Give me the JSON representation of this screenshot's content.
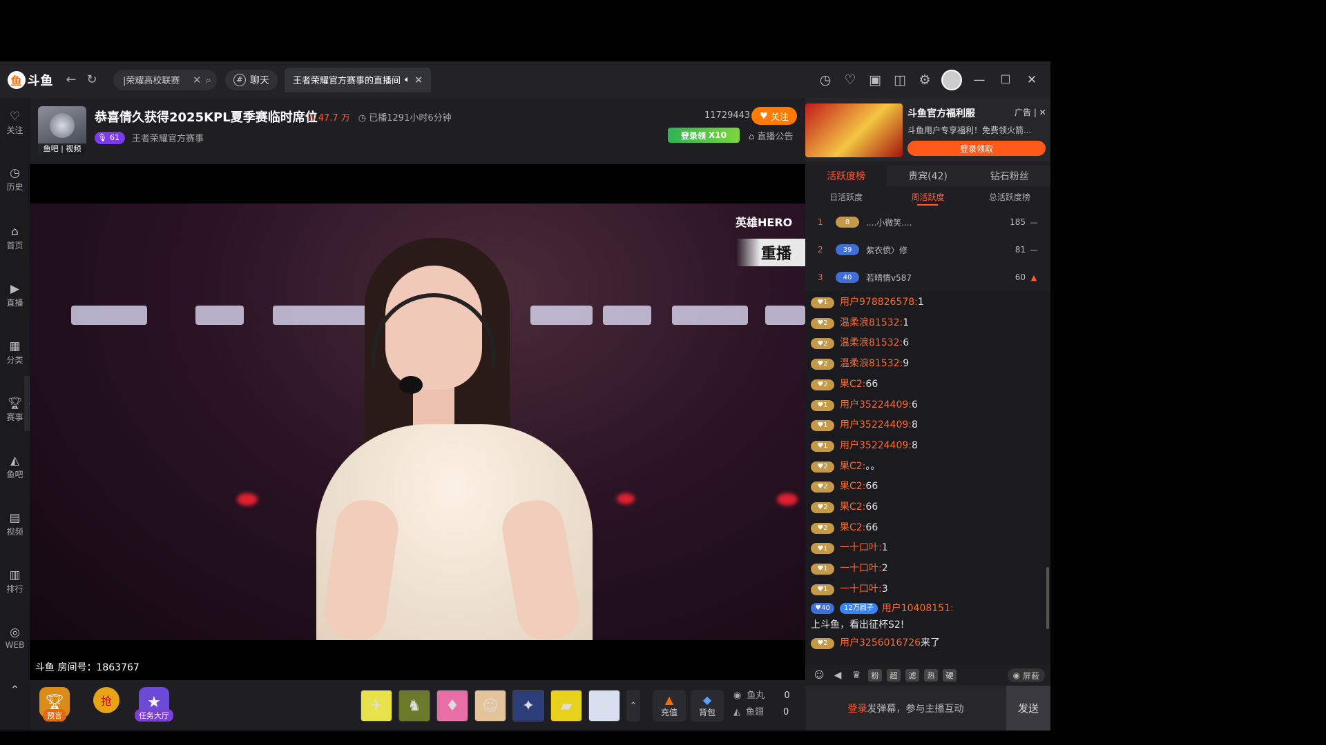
{
  "titlebar": {
    "logo_text": "斗鱼",
    "search_tab_text": "|荣耀高校联赛",
    "chat_tab_label": "聊天",
    "active_tab_label": "王者荣耀官方赛事的直播间"
  },
  "rail": {
    "items": [
      {
        "label": "关注",
        "icon": "heart-icon"
      },
      {
        "label": "历史",
        "icon": "clock-icon"
      },
      {
        "label": "首页",
        "icon": "home-icon"
      },
      {
        "label": "直播",
        "icon": "live-icon"
      },
      {
        "label": "分类",
        "icon": "grid-icon"
      },
      {
        "label": "赛事",
        "icon": "trophy-icon"
      },
      {
        "label": "鱼吧",
        "icon": "fish-bar-icon"
      },
      {
        "label": "视频",
        "icon": "video-icon"
      },
      {
        "label": "排行",
        "icon": "rank-icon"
      },
      {
        "label": "WEB",
        "icon": "web-icon"
      }
    ]
  },
  "room": {
    "title": "恭喜倩久获得2025KPL夏季赛临时席位",
    "heat": "47.7 万",
    "duration": "已播1291小时6分钟",
    "level": "61",
    "anchor_name": "王者荣耀官方赛事",
    "avatar_tag": "鱼吧 | 视频",
    "room_number_count": "11729443",
    "follow_label": "关注",
    "login_promo": "登录领",
    "login_promo_mult": "X10",
    "notice_label": "直播公告"
  },
  "video": {
    "hero_logo": "英雄HERO",
    "replay_label": "重播",
    "room_watermark": "斗鱼 房间号：1863767"
  },
  "bottom": {
    "predict_label": "预言",
    "grab_label": "抢",
    "task_label": "任务大厅",
    "recharge_label": "充值",
    "backpack_label": "背包",
    "fishball_label": "鱼丸",
    "fishball_value": "0",
    "fishwing_label": "鱼翅",
    "fishwing_value": "0"
  },
  "ad": {
    "title": "斗鱼官方福利服",
    "tag": "广告 |",
    "desc": "斗鱼用户专享福利！免费领火箭...",
    "button": "登录领取"
  },
  "rank": {
    "tabs": [
      "活跃度榜",
      "贵宾(42)",
      "钻石粉丝"
    ],
    "sub_tabs": [
      "日活跃度",
      "周活跃度",
      "总活跃度榜"
    ],
    "rows": [
      {
        "pos": "1",
        "level": "8",
        "name": "....小微笑....",
        "score": "185",
        "trend": "—"
      },
      {
        "pos": "2",
        "level": "39",
        "name": "紫衣偾〉修",
        "score": "81",
        "trend": "—"
      },
      {
        "pos": "3",
        "level": "40",
        "name": "若晴情v587",
        "score": "60",
        "trend": "▲"
      }
    ]
  },
  "chat": {
    "messages": [
      {
        "lv": "1",
        "user": "用户978826578:",
        "text": "1"
      },
      {
        "lv": "2",
        "user": "温柔浪81532:",
        "text": "1"
      },
      {
        "lv": "2",
        "user": "温柔浪81532:",
        "text": "6"
      },
      {
        "lv": "2",
        "user": "温柔浪81532:",
        "text": "9"
      },
      {
        "lv": "2",
        "user": "果C2:",
        "text": "66"
      },
      {
        "lv": "1",
        "user": "用户35224409:",
        "text": "6"
      },
      {
        "lv": "1",
        "user": "用户35224409:",
        "text": "8"
      },
      {
        "lv": "1",
        "user": "用户35224409:",
        "text": "8"
      },
      {
        "lv": "2",
        "user": "果C2:",
        "text": "。。"
      },
      {
        "lv": "2",
        "user": "果C2:",
        "text": "66"
      },
      {
        "lv": "2",
        "user": "果C2:",
        "text": "66"
      },
      {
        "lv": "2",
        "user": "果C2:",
        "text": "66"
      },
      {
        "lv": "1",
        "user": "一十口叶:",
        "text": "1"
      },
      {
        "lv": "1",
        "user": "一十口叶:",
        "text": "2"
      },
      {
        "lv": "1",
        "user": "一十口叶:",
        "text": "3"
      }
    ],
    "special": {
      "lv": "40",
      "fan_level": "12",
      "fan_name": "万圆子",
      "user": "用户10408151:",
      "text": "上斗鱼，看出征杯S2!"
    },
    "enter": {
      "lv": "2",
      "user": "用户3256016726",
      "text": "来了"
    },
    "tools": [
      "粉",
      "超",
      "滤",
      "热",
      "硬"
    ],
    "shield_label": "屏蔽",
    "input_login": "登录",
    "input_rest": "发弹幕，参与主播互动",
    "send_label": "发送"
  },
  "colors": {
    "accent": "#ff5b35",
    "follow": "#ff7a00"
  }
}
